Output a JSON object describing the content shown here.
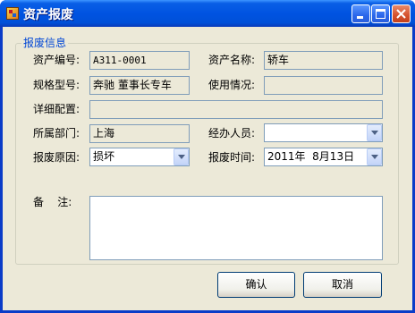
{
  "window": {
    "title": "资产报废"
  },
  "group": {
    "title": "报废信息"
  },
  "labels": {
    "asset_no": "资产编号:",
    "asset_name": "资产名称:",
    "model": "规格型号:",
    "usage": "使用情况:",
    "config": "详细配置:",
    "department": "所属部门:",
    "handler": "经办人员:",
    "reason": "报废原因:",
    "date": "报废时间:",
    "remark": "备    注:"
  },
  "values": {
    "asset_no": "A311-0001",
    "asset_name": "轿车",
    "model": "奔驰 董事长专车",
    "usage": "",
    "config": "",
    "department": "上海",
    "handler": "",
    "reason": "损坏",
    "date": "2011年  8月13日",
    "remark": ""
  },
  "buttons": {
    "ok": "确认",
    "cancel": "取消"
  },
  "icons": {
    "window": "app-icon",
    "minimize": "minimize-icon",
    "maximize": "maximize-icon",
    "close": "close-icon",
    "dropdown": "chevron-down-icon"
  },
  "colors": {
    "titlebar": "#0053e1",
    "client": "#ece9d8",
    "group_title": "#0046d5",
    "close_button": "#d4512c"
  }
}
